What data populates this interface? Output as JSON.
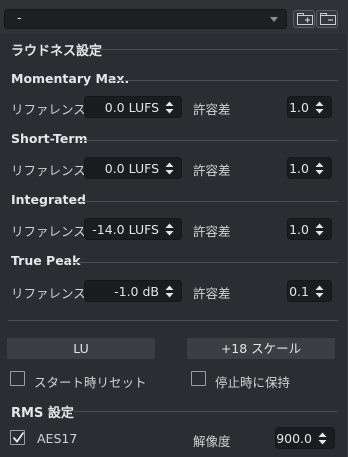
{
  "preset": {
    "value": "-"
  },
  "loudness": {
    "title": "ラウドネス設定",
    "sections": [
      {
        "title": "Momentary Max.",
        "ref_label": "リファレンス.",
        "ref_value": "0.0 LUFS",
        "tol_label": "許容差",
        "tol_value": "1.0"
      },
      {
        "title": "Short-Term",
        "ref_label": "リファレンス.",
        "ref_value": "0.0 LUFS",
        "tol_label": "許容差",
        "tol_value": "1.0"
      },
      {
        "title": "Integrated",
        "ref_label": "リファレンス.",
        "ref_value": "-14.0 LUFS",
        "tol_label": "許容差",
        "tol_value": "1.0"
      },
      {
        "title": "True Peak",
        "ref_label": "リファレンス.",
        "ref_value": "-1.0 dB",
        "tol_label": "許容差",
        "tol_value": "0.1"
      }
    ]
  },
  "buttons": {
    "lu": "LU",
    "scale": "+18 スケール"
  },
  "options": {
    "restart_reset": {
      "label": "スタート時リセット",
      "checked": false
    },
    "hold_on_stop": {
      "label": "停止時に保持",
      "checked": false
    }
  },
  "rms": {
    "title": "RMS 設定",
    "aes17": {
      "label": "AES17",
      "checked": true
    },
    "resolution_label": "解像度",
    "resolution_value": "900.0"
  },
  "colors": {
    "panel": "#2a2d31",
    "field": "#1a1c1f",
    "button": "#3b3e43"
  }
}
